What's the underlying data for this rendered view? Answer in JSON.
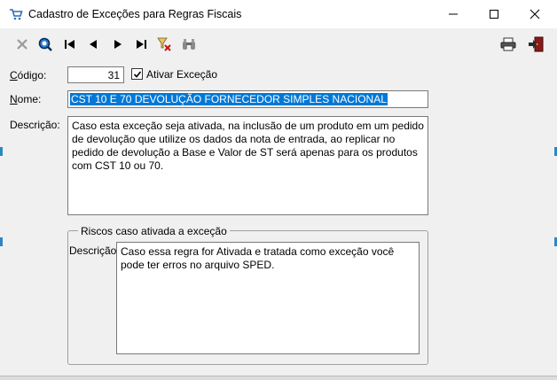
{
  "window": {
    "title": "Cadastro de Exceções para Regras Fiscais",
    "icon": "cart-icon"
  },
  "toolbar": {
    "buttons": [
      "cancel-icon",
      "search-icon",
      "first-record-icon",
      "previous-record-icon",
      "next-record-icon",
      "last-record-icon",
      "clear-filter-icon",
      "binoculars-icon",
      "print-icon",
      "exit-icon"
    ]
  },
  "form": {
    "codigo_label": "ódigo:",
    "codigo_label_u": "C",
    "codigo_value": "31",
    "ativar_label": "Ativar Exceção",
    "ativar_checked": true,
    "nome_label": "ome:",
    "nome_label_u": "N",
    "nome_value": "CST 10 E 70 DEVOLUÇÃO FORNECEDOR SIMPLES NACIONAL",
    "descricao_label": "Descrição:",
    "descricao_value": "Caso esta exceção seja ativada, na inclusão de um produto em um pedido de devolução que utilize os dados da nota de entrada, ao replicar no pedido de devolução a Base e Valor de ST será apenas para os produtos com CST 10 ou 70."
  },
  "riscos": {
    "group_title": "Riscos caso ativada a exceção",
    "descricao_label": "Descrição:",
    "descricao_value": "Caso essa regra for Ativada e tratada como exceção você pode ter erros no arquivo SPED."
  }
}
